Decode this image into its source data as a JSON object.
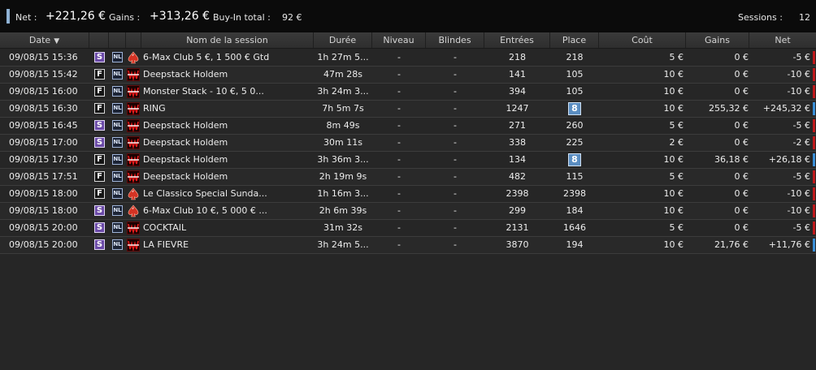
{
  "summary": {
    "net_label": "Net :",
    "net_value": "+221,26 €",
    "gains_label": "Gains :",
    "gains_value": "+313,26 €",
    "buyin_label": "Buy-In total :",
    "buyin_value": "92 €",
    "sessions_label": "Sessions :",
    "sessions_value": "12"
  },
  "columns": {
    "date": "Date",
    "session_name": "Nom de la session",
    "duration": "Durée",
    "level": "Niveau",
    "blinds": "Blindes",
    "entries": "Entrées",
    "place": "Place",
    "cost": "Coût",
    "gains": "Gains",
    "net": "Net"
  },
  "colors": {
    "positive": "#3a8fd8",
    "negative": "#c0191c",
    "place_highlight": "#5b8ec2",
    "speed_s": "#6b4aa8"
  },
  "rows": [
    {
      "date": "09/08/15 15:36",
      "speed": "S",
      "game": "NL",
      "room": "spade",
      "name": "6-Max Club 5 €, 1 500 € Gtd",
      "duration": "1h 27m 5...",
      "level": "-",
      "blinds": "-",
      "entries": "218",
      "place": "218",
      "place_highlight": false,
      "cost": "5 €",
      "gains": "0 €",
      "net": "-5 €",
      "result": "negative"
    },
    {
      "date": "09/08/15 15:42",
      "speed": "F",
      "game": "NL",
      "room": "winamax",
      "name": "Deepstack Holdem",
      "duration": "47m 28s",
      "level": "-",
      "blinds": "-",
      "entries": "141",
      "place": "105",
      "place_highlight": false,
      "cost": "10 €",
      "gains": "0 €",
      "net": "-10 €",
      "result": "negative"
    },
    {
      "date": "09/08/15 16:00",
      "speed": "F",
      "game": "NL",
      "room": "winamax",
      "name": "Monster Stack - 10 €, 5 0...",
      "duration": "3h 24m 3...",
      "level": "-",
      "blinds": "-",
      "entries": "394",
      "place": "105",
      "place_highlight": false,
      "cost": "10 €",
      "gains": "0 €",
      "net": "-10 €",
      "result": "negative"
    },
    {
      "date": "09/08/15 16:30",
      "speed": "F",
      "game": "NL",
      "room": "winamax",
      "name": "RING",
      "duration": "7h 5m 7s",
      "level": "-",
      "blinds": "-",
      "entries": "1247",
      "place": "8",
      "place_highlight": true,
      "cost": "10 €",
      "gains": "255,32 €",
      "net": "+245,32 €",
      "result": "positive"
    },
    {
      "date": "09/08/15 16:45",
      "speed": "S",
      "game": "NL",
      "room": "winamax",
      "name": "Deepstack Holdem",
      "duration": "8m 49s",
      "level": "-",
      "blinds": "-",
      "entries": "271",
      "place": "260",
      "place_highlight": false,
      "cost": "5 €",
      "gains": "0 €",
      "net": "-5 €",
      "result": "negative"
    },
    {
      "date": "09/08/15 17:00",
      "speed": "S",
      "game": "NL",
      "room": "winamax",
      "name": "Deepstack Holdem",
      "duration": "30m 11s",
      "level": "-",
      "blinds": "-",
      "entries": "338",
      "place": "225",
      "place_highlight": false,
      "cost": "2 €",
      "gains": "0 €",
      "net": "-2 €",
      "result": "negative"
    },
    {
      "date": "09/08/15 17:30",
      "speed": "F",
      "game": "NL",
      "room": "winamax",
      "name": "Deepstack Holdem",
      "duration": "3h 36m 3...",
      "level": "-",
      "blinds": "-",
      "entries": "134",
      "place": "8",
      "place_highlight": true,
      "cost": "10 €",
      "gains": "36,18 €",
      "net": "+26,18 €",
      "result": "positive"
    },
    {
      "date": "09/08/15 17:51",
      "speed": "F",
      "game": "NL",
      "room": "winamax",
      "name": "Deepstack Holdem",
      "duration": "2h 19m 9s",
      "level": "-",
      "blinds": "-",
      "entries": "482",
      "place": "115",
      "place_highlight": false,
      "cost": "5 €",
      "gains": "0 €",
      "net": "-5 €",
      "result": "negative"
    },
    {
      "date": "09/08/15 18:00",
      "speed": "F",
      "game": "NL",
      "room": "spade",
      "name": "Le Classico Special Sunda...",
      "duration": "1h 16m 3...",
      "level": "-",
      "blinds": "-",
      "entries": "2398",
      "place": "2398",
      "place_highlight": false,
      "cost": "10 €",
      "gains": "0 €",
      "net": "-10 €",
      "result": "negative"
    },
    {
      "date": "09/08/15 18:00",
      "speed": "S",
      "game": "NL",
      "room": "spade",
      "name": "6-Max Club 10 €, 5 000 € ...",
      "duration": "2h 6m 39s",
      "level": "-",
      "blinds": "-",
      "entries": "299",
      "place": "184",
      "place_highlight": false,
      "cost": "10 €",
      "gains": "0 €",
      "net": "-10 €",
      "result": "negative"
    },
    {
      "date": "09/08/15 20:00",
      "speed": "S",
      "game": "NL",
      "room": "winamax",
      "name": "COCKTAIL",
      "duration": "31m 32s",
      "level": "-",
      "blinds": "-",
      "entries": "2131",
      "place": "1646",
      "place_highlight": false,
      "cost": "5 €",
      "gains": "0 €",
      "net": "-5 €",
      "result": "negative"
    },
    {
      "date": "09/08/15 20:00",
      "speed": "S",
      "game": "NL",
      "room": "winamax",
      "name": "LA FIEVRE",
      "duration": "3h 24m 5...",
      "level": "-",
      "blinds": "-",
      "entries": "3870",
      "place": "194",
      "place_highlight": false,
      "cost": "10 €",
      "gains": "21,76 €",
      "net": "+11,76 €",
      "result": "positive"
    }
  ]
}
